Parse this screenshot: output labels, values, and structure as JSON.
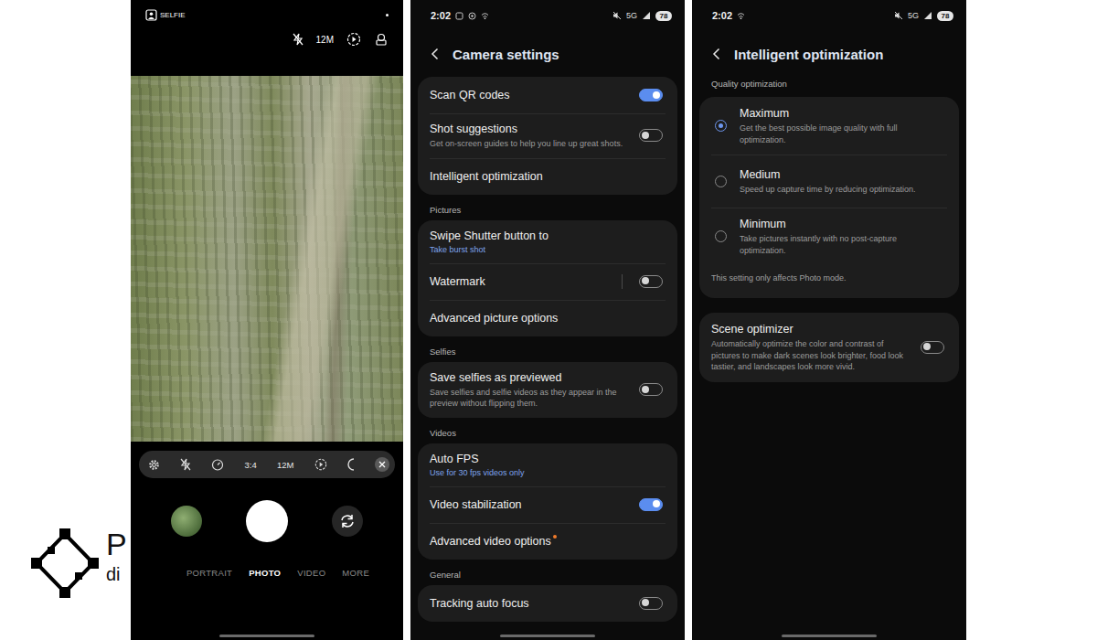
{
  "logo": {
    "text": "P",
    "subtext": "di"
  },
  "camera": {
    "mode_label": "SELFIE",
    "resolution": "12M",
    "quick_settings": [
      "3:4",
      "12M"
    ],
    "modes": [
      {
        "label": "PORTRAIT",
        "selected": false
      },
      {
        "label": "PHOTO",
        "selected": true
      },
      {
        "label": "VIDEO",
        "selected": false
      },
      {
        "label": "MORE",
        "selected": false
      }
    ]
  },
  "status_bar": {
    "time": "2:02",
    "network": "5G",
    "battery": "78"
  },
  "camera_settings": {
    "title": "Camera settings",
    "groups": [
      {
        "items": [
          {
            "label": "Scan QR codes",
            "kind": "toggle",
            "on": true
          },
          {
            "label": "Shot suggestions",
            "description": "Get on-screen guides to help you line up great shots.",
            "kind": "toggle",
            "on": false
          },
          {
            "label": "Intelligent optimization",
            "kind": "link"
          }
        ]
      },
      {
        "heading": "Pictures",
        "items": [
          {
            "label": "Swipe Shutter button to",
            "value": "Take burst shot",
            "kind": "link"
          },
          {
            "label": "Watermark",
            "kind": "split-toggle",
            "on": false
          },
          {
            "label": "Advanced picture options",
            "kind": "link"
          }
        ]
      },
      {
        "heading": "Selfies",
        "items": [
          {
            "label": "Save selfies as previewed",
            "description": "Save selfies and selfie videos as they appear in the preview without flipping them.",
            "kind": "toggle",
            "on": false
          }
        ]
      },
      {
        "heading": "Videos",
        "items": [
          {
            "label": "Auto FPS",
            "value": "Use for 30 fps videos only",
            "kind": "link"
          },
          {
            "label": "Video stabilization",
            "kind": "toggle",
            "on": true
          },
          {
            "label": "Advanced video options",
            "kind": "link",
            "new_badge": true
          }
        ]
      },
      {
        "heading": "General",
        "items": [
          {
            "label": "Tracking auto focus",
            "kind": "toggle",
            "on": false
          }
        ]
      }
    ]
  },
  "intelligent_optimization": {
    "title": "Intelligent optimization",
    "section": "Quality optimization",
    "options": [
      {
        "label": "Maximum",
        "description": "Get the best possible image quality with full optimization.",
        "selected": true
      },
      {
        "label": "Medium",
        "description": "Speed up capture time by reducing optimization.",
        "selected": false
      },
      {
        "label": "Minimum",
        "description": "Take pictures instantly with no post-capture optimization.",
        "selected": false
      }
    ],
    "note": "This setting only affects Photo mode.",
    "scene_optimizer": {
      "label": "Scene optimizer",
      "description": "Automatically optimize the color and contrast of pictures to make dark scenes look brighter, food look tastier, and landscapes look more vivid.",
      "on": false
    }
  }
}
